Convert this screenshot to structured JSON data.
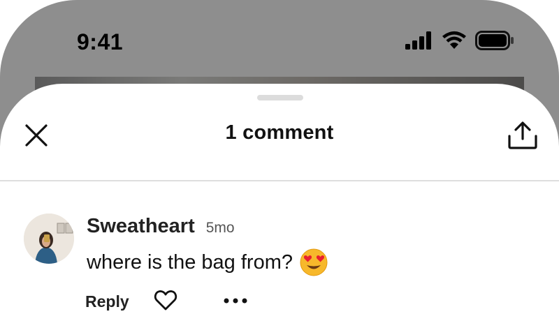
{
  "status_bar": {
    "time": "9:41",
    "icons": [
      "cellular-signal-icon",
      "wifi-icon",
      "battery-icon"
    ]
  },
  "sheet": {
    "title": "1 comment",
    "close_icon": "close-icon",
    "share_icon": "share-icon"
  },
  "comments": [
    {
      "username": "Sweatheart",
      "timestamp": "5mo",
      "text": "where is the bag from?",
      "emoji": "heart-eyes-emoji",
      "actions": {
        "reply_label": "Reply",
        "like_icon": "heart-icon",
        "more_icon": "more-options-icon"
      }
    }
  ],
  "colors": {
    "background_overlay": "#8e8e8e",
    "sheet_bg": "#ffffff",
    "text_primary": "#111111",
    "text_secondary": "#555555",
    "divider": "#dedede"
  }
}
